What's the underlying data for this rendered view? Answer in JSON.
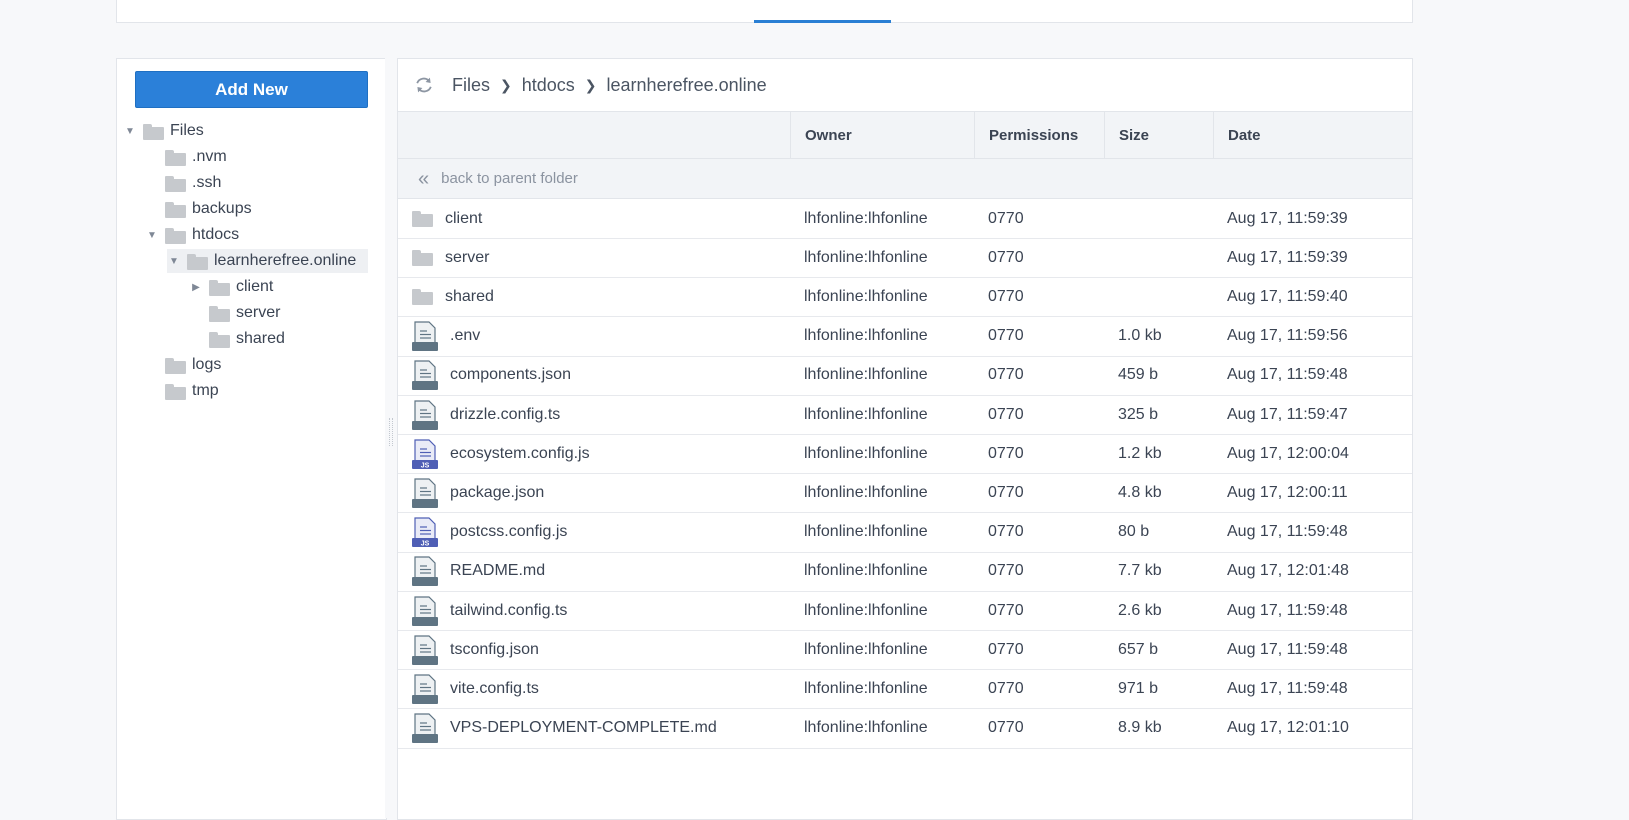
{
  "tree": {
    "add_button": "Add New",
    "nodes": [
      {
        "label": "Files",
        "caret": "down"
      },
      {
        "label": ".nvm",
        "caret": ""
      },
      {
        "label": ".ssh",
        "caret": ""
      },
      {
        "label": "backups",
        "caret": ""
      },
      {
        "label": "htdocs",
        "caret": "down"
      },
      {
        "label": "learnherefree.online",
        "caret": "down",
        "selected": true
      },
      {
        "label": "client",
        "caret": "right"
      },
      {
        "label": "server",
        "caret": ""
      },
      {
        "label": "shared",
        "caret": ""
      },
      {
        "label": "logs",
        "caret": ""
      },
      {
        "label": "tmp",
        "caret": ""
      }
    ]
  },
  "breadcrumb": [
    "Files",
    "htdocs",
    "learnherefree.online"
  ],
  "table": {
    "columns": [
      "Owner",
      "Permissions",
      "Size",
      "Date"
    ],
    "parent_label": "back to parent folder",
    "rows": [
      {
        "name": "client",
        "type": "folder",
        "owner": "lhfonline:lhfonline",
        "perm": "0770",
        "size": "",
        "date": "Aug 17, 11:59:39"
      },
      {
        "name": "server",
        "type": "folder",
        "owner": "lhfonline:lhfonline",
        "perm": "0770",
        "size": "",
        "date": "Aug 17, 11:59:39"
      },
      {
        "name": "shared",
        "type": "folder",
        "owner": "lhfonline:lhfonline",
        "perm": "0770",
        "size": "",
        "date": "Aug 17, 11:59:40"
      },
      {
        "name": ".env",
        "type": "file",
        "owner": "lhfonline:lhfonline",
        "perm": "0770",
        "size": "1.0 kb",
        "date": "Aug 17, 11:59:56"
      },
      {
        "name": "components.json",
        "type": "file",
        "owner": "lhfonline:lhfonline",
        "perm": "0770",
        "size": "459 b",
        "date": "Aug 17, 11:59:48"
      },
      {
        "name": "drizzle.config.ts",
        "type": "file",
        "owner": "lhfonline:lhfonline",
        "perm": "0770",
        "size": "325 b",
        "date": "Aug 17, 11:59:47"
      },
      {
        "name": "ecosystem.config.js",
        "type": "js",
        "owner": "lhfonline:lhfonline",
        "perm": "0770",
        "size": "1.2 kb",
        "date": "Aug 17, 12:00:04"
      },
      {
        "name": "package.json",
        "type": "file",
        "owner": "lhfonline:lhfonline",
        "perm": "0770",
        "size": "4.8 kb",
        "date": "Aug 17, 12:00:11"
      },
      {
        "name": "postcss.config.js",
        "type": "js",
        "owner": "lhfonline:lhfonline",
        "perm": "0770",
        "size": "80 b",
        "date": "Aug 17, 11:59:48"
      },
      {
        "name": "README.md",
        "type": "file",
        "owner": "lhfonline:lhfonline",
        "perm": "0770",
        "size": "7.7 kb",
        "date": "Aug 17, 12:01:48"
      },
      {
        "name": "tailwind.config.ts",
        "type": "file",
        "owner": "lhfonline:lhfonline",
        "perm": "0770",
        "size": "2.6 kb",
        "date": "Aug 17, 11:59:48"
      },
      {
        "name": "tsconfig.json",
        "type": "file",
        "owner": "lhfonline:lhfonline",
        "perm": "0770",
        "size": "657 b",
        "date": "Aug 17, 11:59:48"
      },
      {
        "name": "vite.config.ts",
        "type": "file",
        "owner": "lhfonline:lhfonline",
        "perm": "0770",
        "size": "971 b",
        "date": "Aug 17, 11:59:48"
      },
      {
        "name": "VPS-DEPLOYMENT-COMPLETE.md",
        "type": "file",
        "owner": "lhfonline:lhfonline",
        "perm": "0770",
        "size": "8.9 kb",
        "date": "Aug 17, 12:01:10"
      }
    ]
  },
  "icons": {
    "refresh": "refresh-icon",
    "folder": "folder-icon",
    "file": "file-icon",
    "js": "js-file-icon",
    "parent": "double-chevron-left-icon"
  },
  "colors": {
    "accent": "#2b80d9",
    "folder": "#c6c9cd",
    "file": "#5f7483",
    "js": "#4f5fb5"
  }
}
